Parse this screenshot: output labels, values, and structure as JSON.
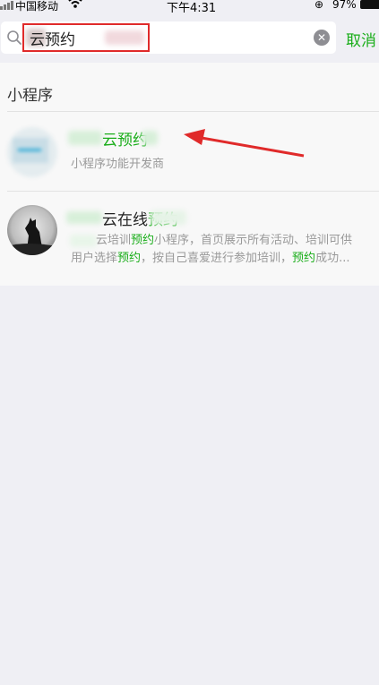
{
  "status_bar": {
    "carrier": "中国移动",
    "time": "下午4:31",
    "battery": "97%"
  },
  "search": {
    "query": "云预约",
    "clear_icon": "clear-icon",
    "cancel_label": "取消"
  },
  "results": {
    "section_title": "小程序",
    "items": [
      {
        "title_parts": [
          "云预约"
        ],
        "subtitle": "小程序功能开发商"
      },
      {
        "title_plain": "云在线",
        "title_highlight": "预约",
        "desc_line1": [
          {
            "text": "云培训",
            "hl": false
          },
          {
            "text": "预约",
            "hl": true
          },
          {
            "text": "小程序，首页展示所有活动、培训可供",
            "hl": false
          }
        ],
        "desc_line2": [
          {
            "text": "用户选择",
            "hl": false
          },
          {
            "text": "预约",
            "hl": true
          },
          {
            "text": "，按自己喜爱进行参加培训，",
            "hl": false
          },
          {
            "text": "预约",
            "hl": true
          },
          {
            "text": "成功...",
            "hl": false
          }
        ]
      }
    ]
  },
  "colors": {
    "accent": "#19ad19",
    "highlight_border": "#e02a2a"
  }
}
